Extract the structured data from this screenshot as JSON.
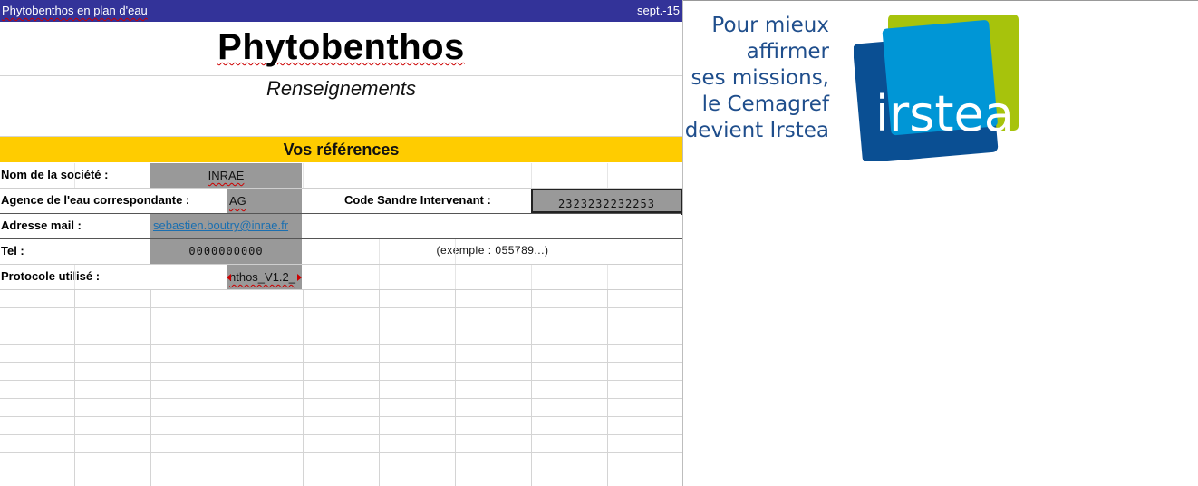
{
  "topbar": {
    "left": "Phytobenthos en plan d'eau",
    "right": "sept.-15"
  },
  "header": {
    "title": "Phytobenthos",
    "subtitle": "Renseignements"
  },
  "section": {
    "title": "Vos références"
  },
  "form": {
    "company": {
      "label": "Nom de la société :",
      "value": "INRAE"
    },
    "agency": {
      "label": "Agence de l'eau correspondante :",
      "value": "AG"
    },
    "sandre": {
      "label": "Code Sandre Intervenant :",
      "value": "2323232232253"
    },
    "email": {
      "label": "Adresse mail :",
      "value": "sebastien.boutry@inrae.fr"
    },
    "tel": {
      "label": "Tel :",
      "value": "0000000000",
      "hint": "(exemple : 055789...)"
    },
    "protocol": {
      "label": "Protocole utilisé :",
      "value": "nthos_V1.2_"
    }
  },
  "side": {
    "slogan": [
      "Pour mieux",
      "affirmer",
      "ses missions,",
      "le Cemagref",
      "devient Irstea"
    ],
    "logo_text": "irstea"
  },
  "colors": {
    "topbar": "#333399",
    "section": "#ffcc00",
    "cell": "#999999",
    "brand_blue": "#1f4e8c"
  }
}
